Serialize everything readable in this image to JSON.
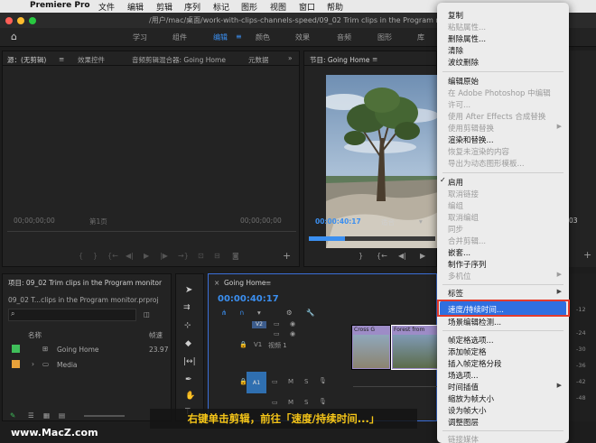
{
  "menubar": {
    "app_name": "Premiere Pro",
    "items": [
      "文件",
      "编辑",
      "剪辑",
      "序列",
      "标记",
      "图形",
      "视图",
      "窗口",
      "帮助"
    ]
  },
  "titlebar": {
    "path": "/用户/mac/桌面/work-with-clips-channels-speed/09_02 Trim clips in the Program monitor.pr"
  },
  "workspaces": [
    "学习",
    "组件",
    "编辑",
    "颜色",
    "效果",
    "音频",
    "图形",
    "库"
  ],
  "source_panel": {
    "tabs": [
      "源：(无剪辑)",
      "效果控件",
      "音频剪辑混合器: Going Home",
      "元数据"
    ],
    "timecode_left": "00;00;00;00",
    "page": "第1页",
    "timecode_right": "00;00;00;00"
  },
  "program_panel": {
    "tab": "节目: Going Home",
    "timecode": "00:00:40:17",
    "fit": "适合",
    "duration_tail": "03"
  },
  "project_panel": {
    "tab": "项目: 09_02 Trim clips in the Program monitor",
    "file": "09_02 T...clips in the Program monitor.prproj",
    "columns": [
      "名称",
      "帧速"
    ],
    "items": [
      {
        "name": "Going Home",
        "rate": "23.97",
        "color": "#3fbf5a"
      },
      {
        "name": "Media",
        "rate": "",
        "color": "#e8a23a"
      }
    ]
  },
  "timeline": {
    "tab": "Going Home",
    "timecode": "00:00:40:17",
    "tracks": [
      {
        "label": "V2"
      },
      {
        "label": "V1",
        "name": "视频 1"
      },
      {
        "label": "A1"
      },
      {
        "label": "A2"
      }
    ],
    "clips": [
      {
        "label": "Cross G"
      },
      {
        "label": "Forest from"
      }
    ]
  },
  "timeline_ruler": [
    "-12",
    "-24",
    "-30",
    "-36",
    "-42",
    "-48"
  ],
  "context_menu": {
    "groups": [
      [
        {
          "label": "复制",
          "enabled": true
        },
        {
          "label": "粘贴属性...",
          "enabled": false
        },
        {
          "label": "删除属性...",
          "enabled": true
        },
        {
          "label": "清除",
          "enabled": true
        },
        {
          "label": "波纹删除",
          "enabled": true
        }
      ],
      [
        {
          "label": "编辑原始",
          "enabled": true
        },
        {
          "label": "在 Adobe Photoshop 中编辑",
          "enabled": false
        },
        {
          "label": "许可...",
          "enabled": false
        },
        {
          "label": "使用 After Effects 合成替换",
          "enabled": false
        },
        {
          "label": "使用剪辑替换",
          "enabled": false,
          "submenu": true
        },
        {
          "label": "渲染和替换...",
          "enabled": true
        },
        {
          "label": "恢复未渲染的内容",
          "enabled": false
        },
        {
          "label": "导出为动态图形模板...",
          "enabled": false
        }
      ],
      [
        {
          "label": "启用",
          "enabled": true,
          "checked": true
        },
        {
          "label": "取消链接",
          "enabled": false
        },
        {
          "label": "编组",
          "enabled": false
        },
        {
          "label": "取消编组",
          "enabled": false
        },
        {
          "label": "同步",
          "enabled": false
        },
        {
          "label": "合并剪辑...",
          "enabled": false
        },
        {
          "label": "嵌套...",
          "enabled": true
        },
        {
          "label": "制作子序列",
          "enabled": true
        },
        {
          "label": "多机位",
          "enabled": false,
          "submenu": true
        }
      ],
      [
        {
          "label": "标签",
          "enabled": true,
          "submenu": true
        }
      ],
      [
        {
          "label": "速度/持续时间...",
          "enabled": true,
          "highlighted": true
        },
        {
          "label": "场景编辑检测...",
          "enabled": true
        }
      ],
      [
        {
          "label": "帧定格选项...",
          "enabled": true
        },
        {
          "label": "添加帧定格",
          "enabled": true
        },
        {
          "label": "插入帧定格分段",
          "enabled": true
        },
        {
          "label": "场选项...",
          "enabled": true
        },
        {
          "label": "时间插值",
          "enabled": true,
          "submenu": true
        },
        {
          "label": "缩放为帧大小",
          "enabled": true
        },
        {
          "label": "设为帧大小",
          "enabled": true
        },
        {
          "label": "调整图层",
          "enabled": true
        }
      ],
      [
        {
          "label": "链接媒体",
          "enabled": false
        }
      ]
    ]
  },
  "caption": "右键单击剪辑，前往「速度/持续时间...」",
  "watermark": "www.MacZ.com",
  "colors": {
    "accent": "#3b8ff0",
    "highlight": "#2f6fe0",
    "caption": "#f5c518",
    "annotation": "#e23b2c"
  }
}
